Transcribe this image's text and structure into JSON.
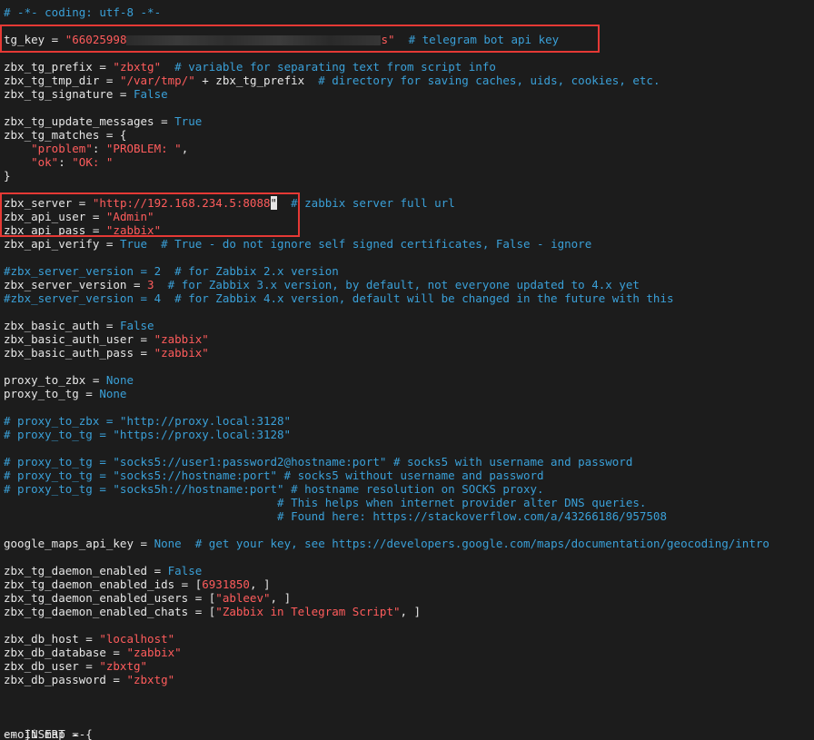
{
  "editor": {
    "mode": "-- INSERT --",
    "cursor_char": "\""
  },
  "lines": [
    [
      {
        "k": "c",
        "t": "# -*- coding: utf-8 -*-"
      }
    ],
    [],
    [
      {
        "k": "t",
        "t": "tg_key = "
      },
      {
        "k": "s",
        "t": "\"66025998"
      },
      {
        "k": "redact",
        "t": ""
      },
      {
        "k": "s",
        "t": "s\""
      },
      {
        "k": "t",
        "t": "  "
      },
      {
        "k": "c",
        "t": "# telegram bot api key"
      }
    ],
    [],
    [
      {
        "k": "t",
        "t": "zbx_tg_prefix = "
      },
      {
        "k": "s",
        "t": "\"zbxtg\""
      },
      {
        "k": "t",
        "t": "  "
      },
      {
        "k": "c",
        "t": "# variable for separating text from script info"
      }
    ],
    [
      {
        "k": "t",
        "t": "zbx_tg_tmp_dir = "
      },
      {
        "k": "s",
        "t": "\"/var/tmp/\""
      },
      {
        "k": "t",
        "t": " + zbx_tg_prefix  "
      },
      {
        "k": "c",
        "t": "# directory for saving caches, uids, cookies, etc."
      }
    ],
    [
      {
        "k": "t",
        "t": "zbx_tg_signature = "
      },
      {
        "k": "b",
        "t": "False"
      }
    ],
    [],
    [
      {
        "k": "t",
        "t": "zbx_tg_update_messages = "
      },
      {
        "k": "b",
        "t": "True"
      }
    ],
    [
      {
        "k": "t",
        "t": "zbx_tg_matches = {"
      }
    ],
    [
      {
        "k": "t",
        "t": "    "
      },
      {
        "k": "s",
        "t": "\"problem\""
      },
      {
        "k": "t",
        "t": ": "
      },
      {
        "k": "s",
        "t": "\"PROBLEM: \""
      },
      {
        "k": "t",
        "t": ","
      }
    ],
    [
      {
        "k": "t",
        "t": "    "
      },
      {
        "k": "s",
        "t": "\"ok\""
      },
      {
        "k": "t",
        "t": ": "
      },
      {
        "k": "s",
        "t": "\"OK: \""
      }
    ],
    [
      {
        "k": "t",
        "t": "}"
      }
    ],
    [],
    [
      {
        "k": "t",
        "t": "zbx_server = "
      },
      {
        "k": "s",
        "t": "\"http://192.168.234.5:8088"
      },
      {
        "k": "cursor",
        "t": "\""
      },
      {
        "k": "t",
        "t": "  "
      },
      {
        "k": "c",
        "t": "# zabbix server full url"
      }
    ],
    [
      {
        "k": "t",
        "t": "zbx_api_user = "
      },
      {
        "k": "s",
        "t": "\"Admin\""
      }
    ],
    [
      {
        "k": "t",
        "t": "zbx_api_pass = "
      },
      {
        "k": "s",
        "t": "\"zabbix\""
      }
    ],
    [
      {
        "k": "t",
        "t": "zbx_api_verify = "
      },
      {
        "k": "b",
        "t": "True"
      },
      {
        "k": "t",
        "t": "  "
      },
      {
        "k": "c",
        "t": "# True - do not ignore self signed certificates, False - ignore"
      }
    ],
    [],
    [
      {
        "k": "c",
        "t": "#zbx_server_version = 2  # for Zabbix 2.x version"
      }
    ],
    [
      {
        "k": "t",
        "t": "zbx_server_version = "
      },
      {
        "k": "s",
        "t": "3"
      },
      {
        "k": "t",
        "t": "  "
      },
      {
        "k": "c",
        "t": "# for Zabbix 3.x version, by default, not everyone updated to 4.x yet"
      }
    ],
    [
      {
        "k": "c",
        "t": "#zbx_server_version = 4  # for Zabbix 4.x version, default will be changed in the future with this"
      }
    ],
    [],
    [
      {
        "k": "t",
        "t": "zbx_basic_auth = "
      },
      {
        "k": "b",
        "t": "False"
      }
    ],
    [
      {
        "k": "t",
        "t": "zbx_basic_auth_user = "
      },
      {
        "k": "s",
        "t": "\"zabbix\""
      }
    ],
    [
      {
        "k": "t",
        "t": "zbx_basic_auth_pass = "
      },
      {
        "k": "s",
        "t": "\"zabbix\""
      }
    ],
    [],
    [
      {
        "k": "t",
        "t": "proxy_to_zbx = "
      },
      {
        "k": "b",
        "t": "None"
      }
    ],
    [
      {
        "k": "t",
        "t": "proxy_to_tg = "
      },
      {
        "k": "b",
        "t": "None"
      }
    ],
    [],
    [
      {
        "k": "c",
        "t": "# proxy_to_zbx = \"http://proxy.local:3128\""
      }
    ],
    [
      {
        "k": "c",
        "t": "# proxy_to_tg = \"https://proxy.local:3128\""
      }
    ],
    [],
    [
      {
        "k": "c",
        "t": "# proxy_to_tg = \"socks5://user1:password2@hostname:port\" # socks5 with username and password"
      }
    ],
    [
      {
        "k": "c",
        "t": "# proxy_to_tg = \"socks5://hostname:port\" # socks5 without username and password"
      }
    ],
    [
      {
        "k": "c",
        "t": "# proxy_to_tg = \"socks5h://hostname:port\" # hostname resolution on SOCKS proxy."
      }
    ],
    [
      {
        "k": "c",
        "t": "                                        # This helps when internet provider alter DNS queries."
      }
    ],
    [
      {
        "k": "c",
        "t": "                                        # Found here: https://stackoverflow.com/a/43266186/957508"
      }
    ],
    [],
    [
      {
        "k": "t",
        "t": "google_maps_api_key = "
      },
      {
        "k": "b",
        "t": "None"
      },
      {
        "k": "t",
        "t": "  "
      },
      {
        "k": "c",
        "t": "# get your key, see https://developers.google.com/maps/documentation/geocoding/intro"
      }
    ],
    [],
    [
      {
        "k": "t",
        "t": "zbx_tg_daemon_enabled = "
      },
      {
        "k": "b",
        "t": "False"
      }
    ],
    [
      {
        "k": "t",
        "t": "zbx_tg_daemon_enabled_ids = ["
      },
      {
        "k": "s",
        "t": "6931850"
      },
      {
        "k": "t",
        "t": ", ]"
      }
    ],
    [
      {
        "k": "t",
        "t": "zbx_tg_daemon_enabled_users = ["
      },
      {
        "k": "s",
        "t": "\"ableev\""
      },
      {
        "k": "t",
        "t": ", ]"
      }
    ],
    [
      {
        "k": "t",
        "t": "zbx_tg_daemon_enabled_chats = ["
      },
      {
        "k": "s",
        "t": "\"Zabbix in Telegram Script\""
      },
      {
        "k": "t",
        "t": ", ]"
      }
    ],
    [],
    [
      {
        "k": "t",
        "t": "zbx_db_host = "
      },
      {
        "k": "s",
        "t": "\"localhost\""
      }
    ],
    [
      {
        "k": "t",
        "t": "zbx_db_database = "
      },
      {
        "k": "s",
        "t": "\"zabbix\""
      }
    ],
    [
      {
        "k": "t",
        "t": "zbx_db_user = "
      },
      {
        "k": "s",
        "t": "\"zbxtg\""
      }
    ],
    [
      {
        "k": "t",
        "t": "zbx_db_password = "
      },
      {
        "k": "s",
        "t": "\"zbxtg\""
      }
    ],
    [],
    [],
    [],
    [
      {
        "k": "t",
        "t": "emoji_map = {"
      }
    ]
  ]
}
